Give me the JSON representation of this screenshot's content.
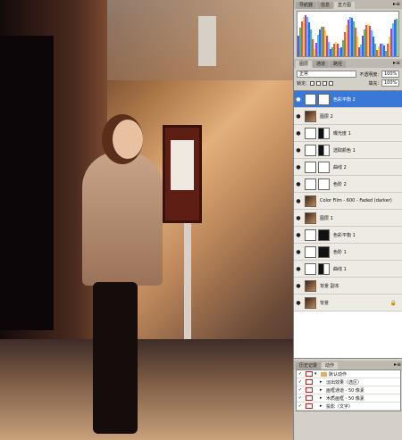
{
  "histogram_tabs": [
    "导航器",
    "信息",
    "直方图"
  ],
  "histogram_active": 2,
  "layers_tabs": [
    "图层",
    "通道",
    "路径"
  ],
  "layers_active": 0,
  "blend_mode": "正常",
  "opacity_label": "不透明度:",
  "opacity_value": "100%",
  "lock_label": "锁定:",
  "fill_label": "填充:",
  "fill_value": "100%",
  "layers": [
    {
      "name": "色彩平衡 2",
      "thumb": "adj",
      "mask": "white",
      "selected": true
    },
    {
      "name": "图层 2",
      "thumb": "photo",
      "mask": "none"
    },
    {
      "name": "曝光度 1",
      "thumb": "adj",
      "mask": "mixed"
    },
    {
      "name": "选取颜色 1",
      "thumb": "adj",
      "mask": "mixed"
    },
    {
      "name": "曲线 2",
      "thumb": "adj",
      "mask": "white"
    },
    {
      "name": "色阶 2",
      "thumb": "adj",
      "mask": "white"
    },
    {
      "name": "Color Film - 600 - Faded (darker)",
      "thumb": "photo",
      "mask": "none"
    },
    {
      "name": "图层 1",
      "thumb": "photo",
      "mask": "none"
    },
    {
      "name": "色彩平衡 1",
      "thumb": "adj",
      "mask": "dark"
    },
    {
      "name": "色阶 1",
      "thumb": "adj",
      "mask": "dark"
    },
    {
      "name": "曲线 1",
      "thumb": "adj",
      "mask": "mixed"
    },
    {
      "name": "背景 副本",
      "thumb": "photo",
      "mask": "none"
    },
    {
      "name": "背景",
      "thumb": "photo",
      "mask": "none",
      "locked": true
    }
  ],
  "actions_tabs": [
    "历史记录",
    "动作"
  ],
  "actions_active": 1,
  "actions": [
    {
      "name": "默认动作",
      "folder": true
    },
    {
      "name": "淡出效果（选区）"
    },
    {
      "name": "画框通道 - 50 像素"
    },
    {
      "name": "木质画框 - 50 像素"
    },
    {
      "name": "投影（文字）"
    }
  ],
  "colors": {
    "selection": "#3a78d8",
    "panel": "#d4d0c8"
  }
}
